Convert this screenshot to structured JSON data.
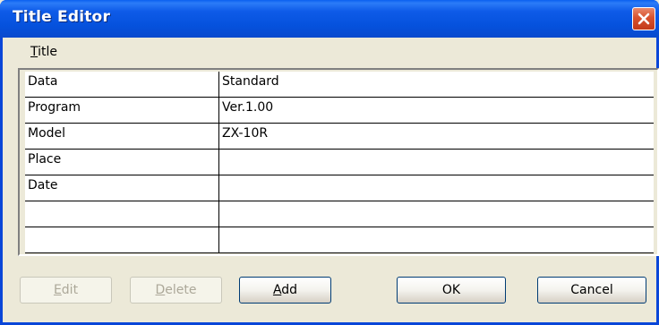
{
  "window": {
    "title": "Title Editor"
  },
  "menu": {
    "title_label": "Title",
    "title_accel": "T",
    "title_rest": "itle"
  },
  "table": {
    "rows": [
      {
        "key": "Data",
        "value": "Standard"
      },
      {
        "key": "Program",
        "value": "Ver.1.00"
      },
      {
        "key": "Model",
        "value": "ZX-10R"
      },
      {
        "key": "Place",
        "value": ""
      },
      {
        "key": "Date",
        "value": ""
      },
      {
        "key": "",
        "value": ""
      },
      {
        "key": "",
        "value": ""
      }
    ]
  },
  "buttons": {
    "edit": {
      "accel": "E",
      "rest": "dit",
      "enabled": false
    },
    "delete": {
      "accel": "D",
      "rest": "elete",
      "enabled": false
    },
    "add": {
      "accel": "A",
      "rest": "dd",
      "enabled": true
    },
    "ok": "OK",
    "cancel": "Cancel"
  },
  "icons": {
    "close": "close-icon"
  },
  "colors": {
    "titlebar": "#0551DC",
    "close": "#D8522E",
    "dialog": "#ECE9D8"
  }
}
